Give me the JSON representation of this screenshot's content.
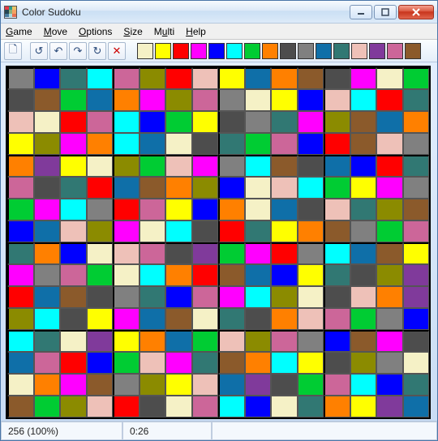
{
  "window": {
    "title": "Color Sudoku",
    "icon_colors": [
      "#e63946",
      "#2a9d8f",
      "#e9c46a",
      "#264653",
      "#8ab17d",
      "#f4a261",
      "#457b9d",
      "#a8dadc",
      "#e76f51"
    ]
  },
  "menu": {
    "items": [
      {
        "label": "Game",
        "mn": "G"
      },
      {
        "label": "Move",
        "mn": "M"
      },
      {
        "label": "Options",
        "mn": "O"
      },
      {
        "label": "Size",
        "mn": "S"
      },
      {
        "label": "Multi",
        "mn": "u"
      },
      {
        "label": "Help",
        "mn": "H"
      }
    ]
  },
  "toolbar": {
    "buttons": [
      {
        "name": "new-game-icon",
        "glyph": "🗋"
      },
      {
        "sep": true
      },
      {
        "name": "undo-all-icon",
        "glyph": "↺"
      },
      {
        "name": "undo-icon",
        "glyph": "↶"
      },
      {
        "name": "redo-icon",
        "glyph": "↷"
      },
      {
        "name": "redo-all-icon",
        "glyph": "↻"
      },
      {
        "name": "clear-icon",
        "glyph": "✕",
        "color": "#c00"
      }
    ]
  },
  "palette": {
    "colors": [
      "#f5f1c6",
      "#ffff00",
      "#ff0000",
      "#ff00ff",
      "#0000ff",
      "#00ffff",
      "#00cc33",
      "#ff8000",
      "#4d4d4d",
      "#808080",
      "#0f6fa8",
      "#317873",
      "#eec1b8",
      "#803a9b",
      "#cc6699",
      "#8b5a2b"
    ]
  },
  "board": {
    "size": 16,
    "box": 4,
    "colormap": {
      "0": "#f5f1c6",
      "1": "#ffff00",
      "2": "#ff0000",
      "3": "#ff00ff",
      "4": "#0000ff",
      "5": "#00ffff",
      "6": "#00cc33",
      "7": "#ff8000",
      "8": "#4d4d4d",
      "9": "#808080",
      "a": "#0f6fa8",
      "b": "#317873",
      "c": "#eec1b8",
      "d": "#803a9b",
      "e": "#cc6699",
      "f": "#8b5a2b",
      "g": "#8b8b00"
    },
    "grid": [
      "94b5eg2c1a7f8306",
      "8f6a73ge9014c52b",
      "c02e546189b3gfa7",
      "1g375a08b6e42fc9",
      "7d10g6c395f8a42b",
      "e8b2af7g40c56139",
      "63592e1470a8cbgf",
      "4acg30582b17f96e",
      "b740ce8d63295af1",
      "39e60572fa41b8gd",
      "2af89b4e35g08c7d",
      "g5813af0b87ce694",
      "5b0d17a6cge94f38",
      "ae246c3bf7518g90",
      "073f9g1cad86e54b",
      "f6gc280e540b71da"
    ]
  },
  "status": {
    "cells": "256  (100%)",
    "time": "0:26"
  }
}
